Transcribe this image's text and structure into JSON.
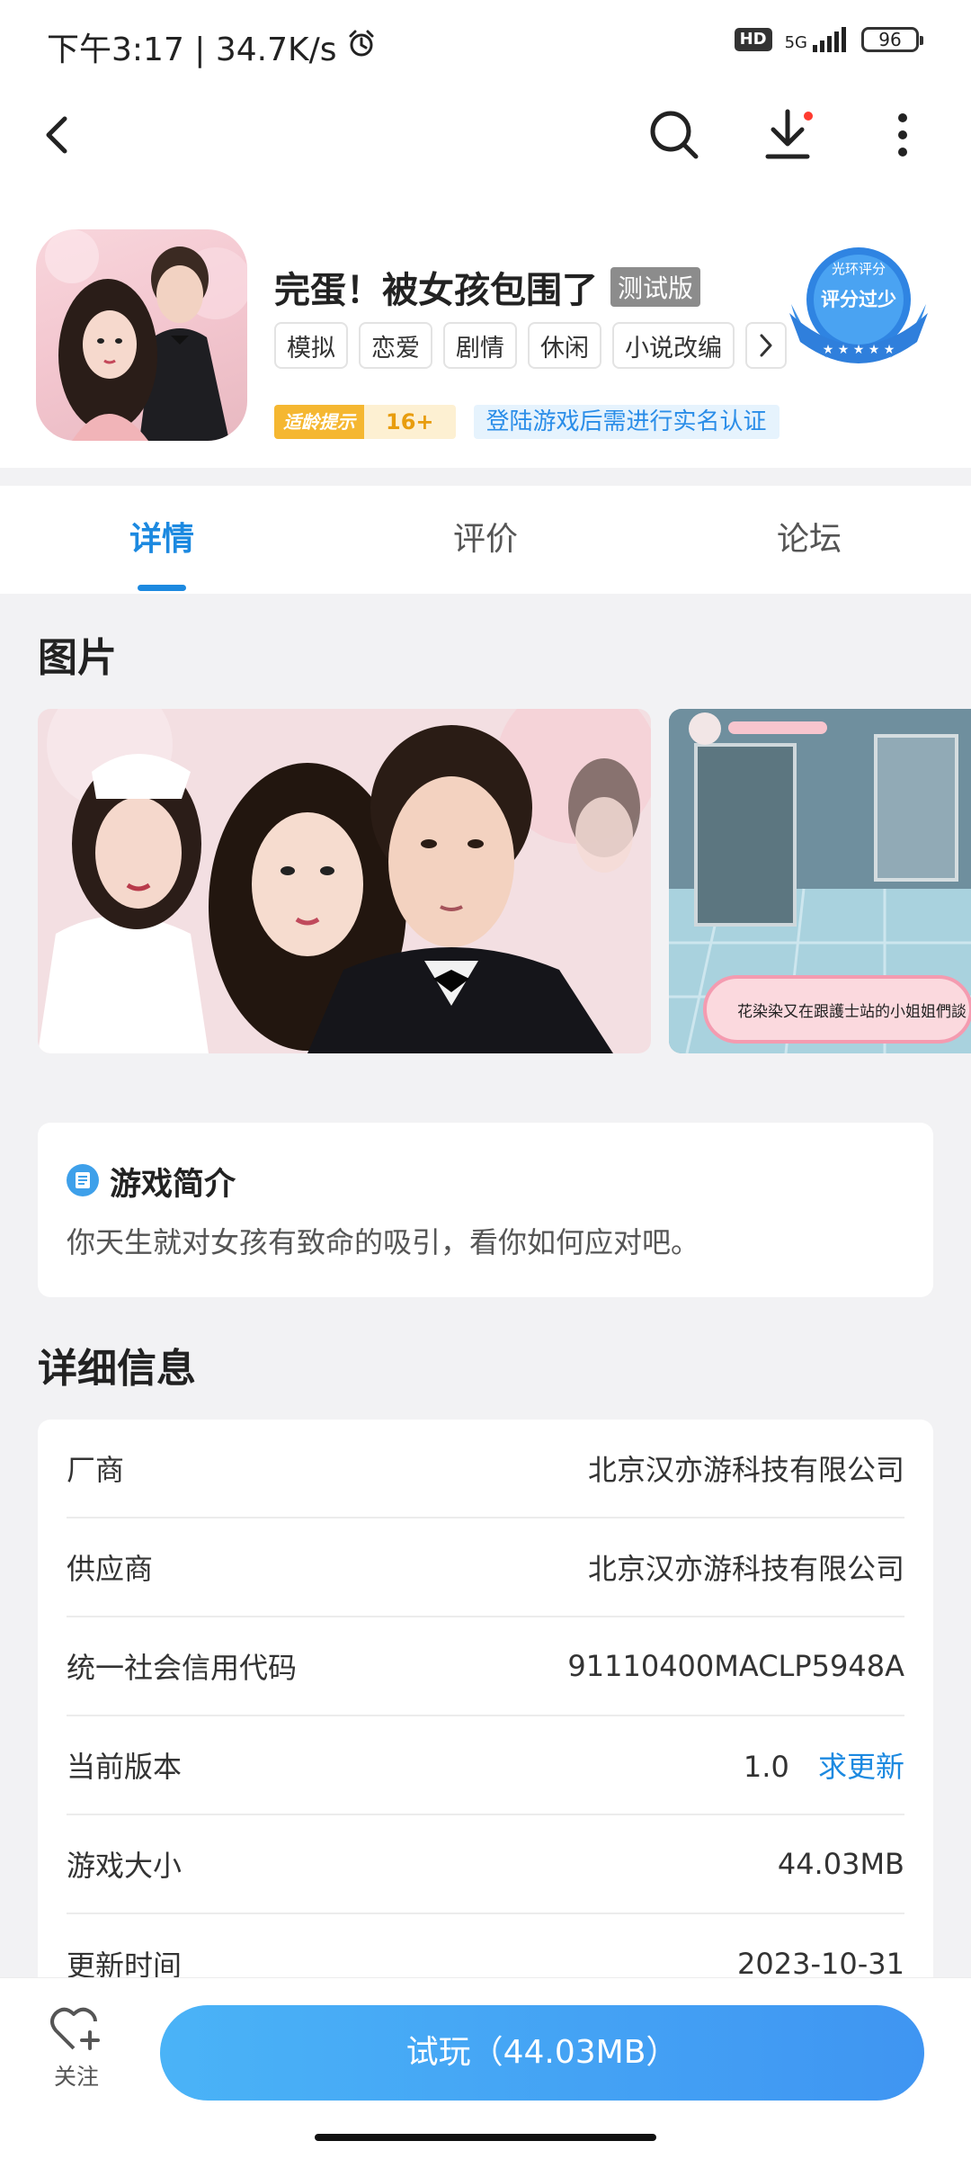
{
  "status_bar": {
    "time_speed": "下午3:17 | 34.7K/s",
    "hd": "HD",
    "network": "5G",
    "battery": "96"
  },
  "app": {
    "title": "完蛋！被女孩包围了",
    "badge": "测试版",
    "tags": [
      "模拟",
      "恋爱",
      "剧情",
      "休闲",
      "小说改编"
    ],
    "age_label": "适龄提示",
    "age_value": "16+",
    "realname_notice": "登陆游戏后需进行实名认证",
    "rating_seal_top": "光环评分",
    "rating_seal_main": "评分过少"
  },
  "tabs": [
    {
      "label": "详情",
      "active": true
    },
    {
      "label": "评价",
      "active": false
    },
    {
      "label": "论坛",
      "active": false
    }
  ],
  "pictures": {
    "title": "图片",
    "screenshot2_caption": "花染染又在跟護士站的小姐姐們談"
  },
  "intro": {
    "title": "游戏简介",
    "text": "你天生就对女孩有致命的吸引，看你如何应对吧。"
  },
  "details": {
    "title": "详细信息",
    "rows": [
      {
        "label": "厂商",
        "value": "北京汉亦游科技有限公司"
      },
      {
        "label": "供应商",
        "value": "北京汉亦游科技有限公司"
      },
      {
        "label": "统一社会信用代码",
        "value": "91110400MACLP5948A"
      },
      {
        "label": "当前版本",
        "value": "1.0",
        "link": "求更新"
      },
      {
        "label": "游戏大小",
        "value": "44.03MB"
      },
      {
        "label": "更新时间",
        "value": "2023-10-31"
      }
    ]
  },
  "bottom_bar": {
    "follow_label": "关注",
    "play_label": "试玩（44.03MB）"
  },
  "colors": {
    "accent": "#1c89e0",
    "play_button": "#3f95f2",
    "age_badge": "#f5b731"
  }
}
